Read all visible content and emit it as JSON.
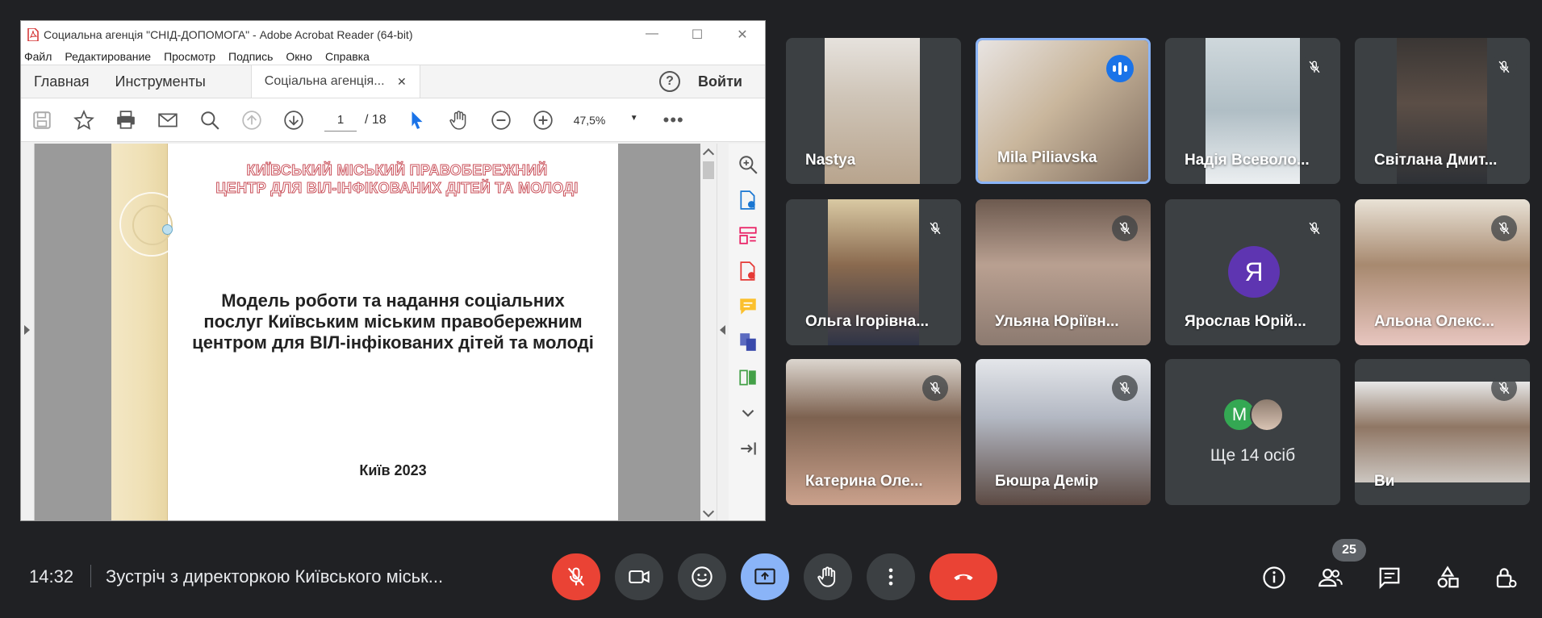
{
  "acrobat": {
    "window_title": "Социальна агенція \"СНІД-ДОПОМОГА\" - Adobe Acrobat Reader (64-bit)",
    "menu": [
      "Файл",
      "Редактирование",
      "Просмотр",
      "Подпись",
      "Окно",
      "Справка"
    ],
    "tabs": {
      "home": "Главная",
      "tools": "Инструменты",
      "document": "Соціальна агенція..."
    },
    "login": "Войти",
    "page_current": "1",
    "page_total": "/ 18",
    "zoom": "47,5%",
    "document": {
      "header_line1": "КИЇВСЬКИЙ МІСЬКИЙ ПРАВОБЕРЕЖНИЙ",
      "header_line2": "ЦЕНТР ДЛЯ ВІЛ-ІНФІКОВАНИХ ДІТЕЙ ТА МОЛОДІ",
      "title_line1": "Модель роботи та надання соціальних",
      "title_line2": "послуг Київським міським правобережним",
      "title_line3": "центром для ВІЛ-інфікованих дітей та молоді",
      "city": "Київ 2023"
    }
  },
  "participants": [
    {
      "name": "Nastya",
      "muted": false,
      "speaking": false
    },
    {
      "name": "Mila Piliavska",
      "muted": false,
      "speaking": true
    },
    {
      "name": "Надія Всеволо...",
      "muted": true,
      "speaking": false
    },
    {
      "name": "Світлана Дмит...",
      "muted": true,
      "speaking": false
    },
    {
      "name": "Ольга Ігорівна...",
      "muted": true,
      "speaking": false
    },
    {
      "name": "Ульяна Юріївн...",
      "muted": true,
      "speaking": false
    },
    {
      "name": "Ярослав Юрій...",
      "muted": true,
      "speaking": false,
      "initial": "Я"
    },
    {
      "name": "Альона Олекс...",
      "muted": true,
      "speaking": false
    },
    {
      "name": "Катерина Оле...",
      "muted": true,
      "speaking": false
    },
    {
      "name": "Бюшра Демір",
      "muted": true,
      "speaking": false
    },
    {
      "name": "Ви",
      "muted": true,
      "speaking": false
    }
  ],
  "more_tile": {
    "initial": "M",
    "label": "Ще 14 осіб"
  },
  "bottom": {
    "time": "14:32",
    "meeting_title": "Зустріч з директоркою Київського міськ...",
    "people_count": "25"
  },
  "colors": {
    "end_call": "#ea4335",
    "present_active": "#8ab4f8",
    "speaking_border": "#8ab4f8",
    "avatar_ya": "#5e35b1",
    "avatar_m": "#34a853"
  }
}
